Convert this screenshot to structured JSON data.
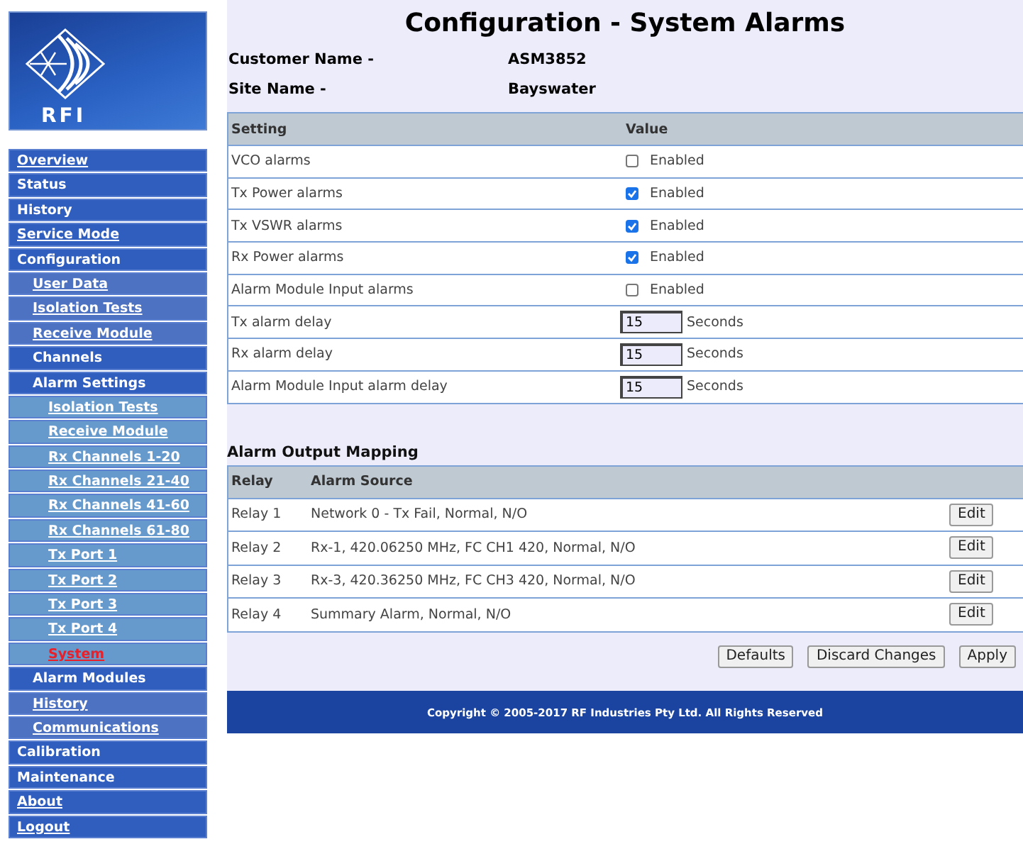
{
  "logo": {
    "text": "RFI"
  },
  "nav": [
    {
      "label": "Overview",
      "link": true,
      "selected": false
    },
    {
      "label": "Status",
      "link": false,
      "selected": false
    },
    {
      "label": "History",
      "link": false,
      "selected": false
    },
    {
      "label": "Service Mode",
      "link": true,
      "selected": false
    },
    {
      "label": "Configuration",
      "link": false,
      "selected": false,
      "children": [
        {
          "label": "User Data",
          "link": true,
          "selected": false
        },
        {
          "label": "Isolation Tests",
          "link": true,
          "selected": false
        },
        {
          "label": "Receive Module",
          "link": true,
          "selected": false
        },
        {
          "label": "Channels",
          "link": false,
          "selected": false
        },
        {
          "label": "Alarm Settings",
          "link": false,
          "selected": false,
          "children": [
            {
              "label": "Isolation Tests",
              "link": true,
              "selected": false
            },
            {
              "label": "Receive Module",
              "link": true,
              "selected": false
            },
            {
              "label": "Rx Channels 1-20",
              "link": true,
              "selected": false
            },
            {
              "label": "Rx Channels 21-40",
              "link": true,
              "selected": false
            },
            {
              "label": "Rx Channels 41-60",
              "link": true,
              "selected": false
            },
            {
              "label": "Rx Channels 61-80",
              "link": true,
              "selected": false
            },
            {
              "label": "Tx Port 1",
              "link": true,
              "selected": false
            },
            {
              "label": "Tx Port 2",
              "link": true,
              "selected": false
            },
            {
              "label": "Tx Port 3",
              "link": true,
              "selected": false
            },
            {
              "label": "Tx Port 4",
              "link": true,
              "selected": false
            },
            {
              "label": "System",
              "link": true,
              "selected": true
            }
          ]
        },
        {
          "label": "Alarm Modules",
          "link": false,
          "selected": false
        },
        {
          "label": "History",
          "link": true,
          "selected": false
        },
        {
          "label": "Communications",
          "link": true,
          "selected": false
        }
      ]
    },
    {
      "label": "Calibration",
      "link": false,
      "selected": false
    },
    {
      "label": "Maintenance",
      "link": false,
      "selected": false
    },
    {
      "label": "About",
      "link": true,
      "selected": false
    },
    {
      "label": "Logout",
      "link": true,
      "selected": false
    }
  ],
  "page_title": "Configuration - System Alarms",
  "info": [
    {
      "label": "Customer Name -",
      "value": "ASM3852"
    },
    {
      "label": "Site Name -",
      "value": "Bayswater"
    }
  ],
  "settings": {
    "columns": [
      "Setting",
      "Value"
    ],
    "rows": [
      {
        "kind": "checkbox",
        "label": "VCO alarms",
        "checked": false,
        "text": "Enabled"
      },
      {
        "kind": "checkbox",
        "label": "Tx Power alarms",
        "checked": true,
        "text": "Enabled"
      },
      {
        "kind": "checkbox",
        "label": "Tx VSWR alarms",
        "checked": true,
        "text": "Enabled"
      },
      {
        "kind": "checkbox",
        "label": "Rx Power alarms",
        "checked": true,
        "text": "Enabled"
      },
      {
        "kind": "checkbox",
        "label": "Alarm Module Input alarms",
        "checked": false,
        "text": "Enabled"
      },
      {
        "kind": "number",
        "label": "Tx alarm delay",
        "value": "15",
        "text": "Seconds"
      },
      {
        "kind": "number",
        "label": "Rx alarm delay",
        "value": "15",
        "text": "Seconds"
      },
      {
        "kind": "number",
        "label": "Alarm Module Input alarm delay",
        "value": "15",
        "text": "Seconds"
      }
    ]
  },
  "mapping": {
    "title": "Alarm Output Mapping",
    "columns": [
      "Relay",
      "Alarm Source"
    ],
    "rows": [
      {
        "relay": "Relay 1",
        "source": "Network 0 - Tx Fail, Normal, N/O",
        "button": "Edit"
      },
      {
        "relay": "Relay 2",
        "source": "Rx-1, 420.06250 MHz, FC CH1 420, Normal, N/O",
        "button": "Edit"
      },
      {
        "relay": "Relay 3",
        "source": "Rx-3, 420.36250 MHz, FC CH3 420, Normal, N/O",
        "button": "Edit"
      },
      {
        "relay": "Relay 4",
        "source": "Summary Alarm, Normal, N/O",
        "button": "Edit"
      }
    ]
  },
  "actions": [
    "Defaults",
    "Discard Changes",
    "Apply"
  ],
  "footer": "Copyright © 2005-2017 RF Industries Pty Ltd. All Rights Reserved"
}
